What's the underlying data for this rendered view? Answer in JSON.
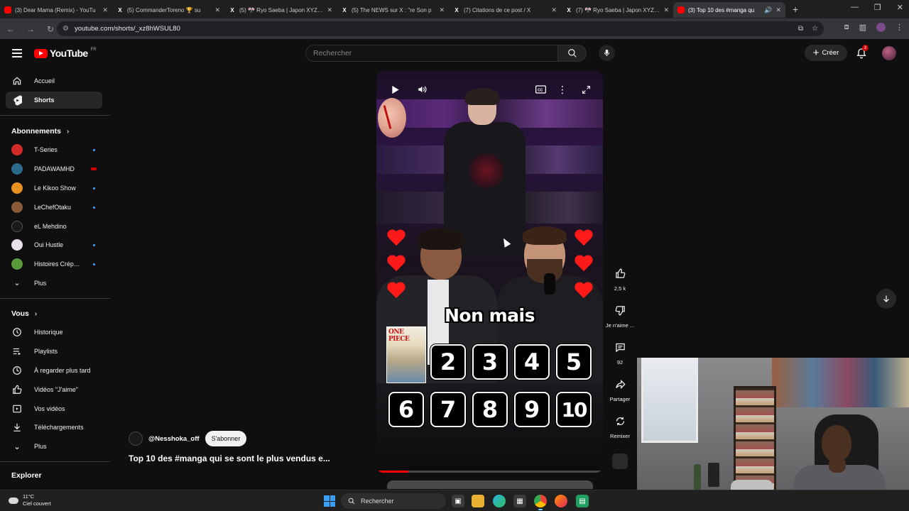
{
  "browser": {
    "tabs": [
      {
        "icon": "youtube-icon",
        "title": "(3) Dear Mama (Remix) - YouTu",
        "active": false
      },
      {
        "icon": "x-icon",
        "title": "(5) CommanderToreno 🏆 su",
        "active": false
      },
      {
        "icon": "x-icon",
        "title": "(5) 🎌 Ryo Saeba | Japon XYZ 🗼",
        "active": false
      },
      {
        "icon": "x-icon",
        "title": "(5) The NEWS sur X : \"re Son p",
        "active": false
      },
      {
        "icon": "x-icon",
        "title": "(7) Citations de ce post / X",
        "active": false
      },
      {
        "icon": "x-icon",
        "title": "(7) 🎌 Ryo Saeba | Japon XYZ 🗼",
        "active": false
      },
      {
        "icon": "youtube-icon",
        "title": "(3) Top 10 des #manga qu",
        "active": true
      }
    ],
    "url": "youtube.com/shorts/_xz8hWSUL80"
  },
  "header": {
    "logo_text": "YouTube",
    "country_code": "FR",
    "search_placeholder": "Rechercher",
    "create_label": "Créer",
    "notification_count": "3"
  },
  "sidebar": {
    "main": [
      {
        "icon": "home-icon",
        "label": "Accueil",
        "active": false
      },
      {
        "icon": "shorts-icon",
        "label": "Shorts",
        "active": true
      }
    ],
    "subscriptions_heading": "Abonnements",
    "subscriptions": [
      {
        "label": "T-Series",
        "color": "#d42a2a",
        "indicator": "dot"
      },
      {
        "label": "PADAWAMHD",
        "color": "#2a6a8a",
        "indicator": "live"
      },
      {
        "label": "Le Kikoo Show",
        "color": "#e89020",
        "indicator": "dot"
      },
      {
        "label": "LeChefOtaku",
        "color": "#8a5a3a",
        "indicator": "dot"
      },
      {
        "label": "eL Mehdino",
        "color": "#1a1a1a",
        "indicator": "none"
      },
      {
        "label": "Oui Hustle",
        "color": "#e8e0e8",
        "indicator": "dot"
      },
      {
        "label": "Histoires Crépues",
        "color": "#5a9a3a",
        "indicator": "dot"
      }
    ],
    "more_label": "Plus",
    "you_heading": "Vous",
    "you_items": [
      {
        "icon": "history-icon",
        "label": "Historique"
      },
      {
        "icon": "playlists-icon",
        "label": "Playlists"
      },
      {
        "icon": "watch-later-icon",
        "label": "À regarder plus tard"
      },
      {
        "icon": "liked-videos-icon",
        "label": "Vidéos \"J'aime\""
      },
      {
        "icon": "your-videos-icon",
        "label": "Vos vidéos"
      },
      {
        "icon": "downloads-icon",
        "label": "Téléchargements"
      },
      {
        "icon": "chevron-down-icon",
        "label": "Plus"
      }
    ],
    "explore_heading": "Explorer"
  },
  "short": {
    "overlay_text": "Non mais",
    "manga_cover_title": "ONE PIECE",
    "rank_numbers": [
      "2",
      "3",
      "4",
      "5",
      "6",
      "7",
      "8",
      "9",
      "10"
    ],
    "progress": 0.14,
    "channel": "@Nesshoka_off",
    "subscribe_label": "S'abonner",
    "title": "Top 10 des #manga qui se sont le plus vendus e..."
  },
  "actions": {
    "like_count": "2,5 k",
    "dislike_label": "Je n'aime ...",
    "comment_count": "92",
    "share_label": "Partager",
    "remix_label": "Remixer"
  },
  "taskbar": {
    "temperature": "11°C",
    "weather": "Ciel couvert",
    "search_label": "Rechercher"
  },
  "colors": {
    "accent": "#ff0000",
    "background": "#0f0f0f",
    "heart": "#ff1a1a"
  }
}
